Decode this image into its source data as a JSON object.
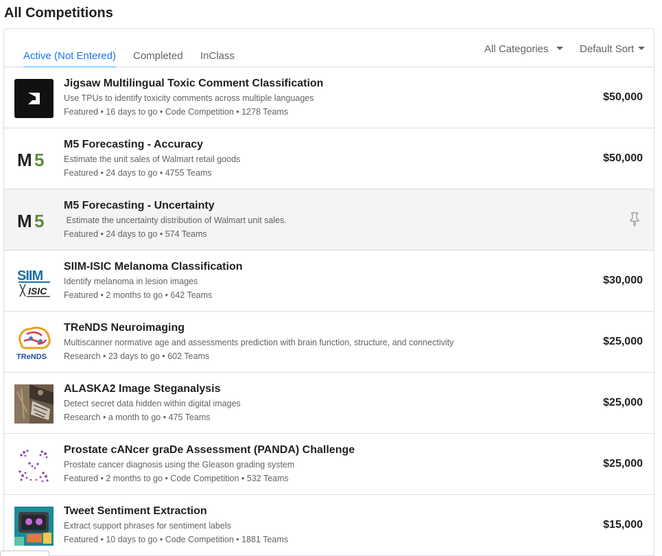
{
  "page": {
    "title": "All Competitions"
  },
  "tabs": [
    {
      "label": "Active (Not Entered)"
    },
    {
      "label": "Completed"
    },
    {
      "label": "InClass"
    }
  ],
  "filters": {
    "category": "All Categories",
    "sort": "Default Sort"
  },
  "competitions": [
    {
      "title": "Jigsaw Multilingual Toxic Comment Classification",
      "description": "Use TPUs to identify toxicity comments across multiple languages",
      "meta": "Featured • 16 days to go • Code Competition • 1278 Teams",
      "prize": "$50,000"
    },
    {
      "title": "M5 Forecasting - Accuracy",
      "description": "Estimate the unit sales of Walmart retail goods",
      "meta": "Featured • 24 days to go • 4755 Teams",
      "prize": "$50,000",
      "logo_text": "M5"
    },
    {
      "title": "M5 Forecasting - Uncertainty",
      "description": " Estimate the uncertainty distribution of Walmart unit sales.",
      "meta": "Featured • 24 days to go • 574 Teams",
      "prize": "",
      "logo_text": "M5"
    },
    {
      "title": "SIIM-ISIC Melanoma Classification",
      "description": "Identify melanoma in lesion images",
      "meta": "Featured • 2 months to go • 642 Teams",
      "prize": "$30,000",
      "logo_text_top": "SIIM",
      "logo_text_bottom": "ISIC"
    },
    {
      "title": "TReNDS Neuroimaging",
      "description": "Multiscanner normative age and assessments prediction with brain function, structure, and connectivity",
      "meta": "Research • 23 days to go • 602 Teams",
      "prize": "$25,000",
      "logo_text": "TReNDS"
    },
    {
      "title": "ALASKA2 Image Steganalysis",
      "description": "Detect secret data hidden within digital images",
      "meta": "Research • a month to go • 475 Teams",
      "prize": "$25,000"
    },
    {
      "title": "Prostate cANcer graDe Assessment (PANDA) Challenge",
      "description": "Prostate cancer diagnosis using the Gleason grading system",
      "meta": "Featured • 2 months to go • Code Competition • 532 Teams",
      "prize": "$25,000"
    },
    {
      "title": "Tweet Sentiment Extraction",
      "description": "Extract support phrases for sentiment labels",
      "meta": "Featured • 10 days to go • Code Competition • 1881 Teams",
      "prize": "$15,000"
    }
  ],
  "icons": {
    "pin": "pin-icon",
    "caret": "caret-down-icon"
  },
  "colors": {
    "accent": "#20beff",
    "tab_active_text": "#1a73e8",
    "m5_green": "#5a8f3c",
    "siim_blue": "#1b6fa8",
    "trends_blue": "#1f4e9c"
  }
}
